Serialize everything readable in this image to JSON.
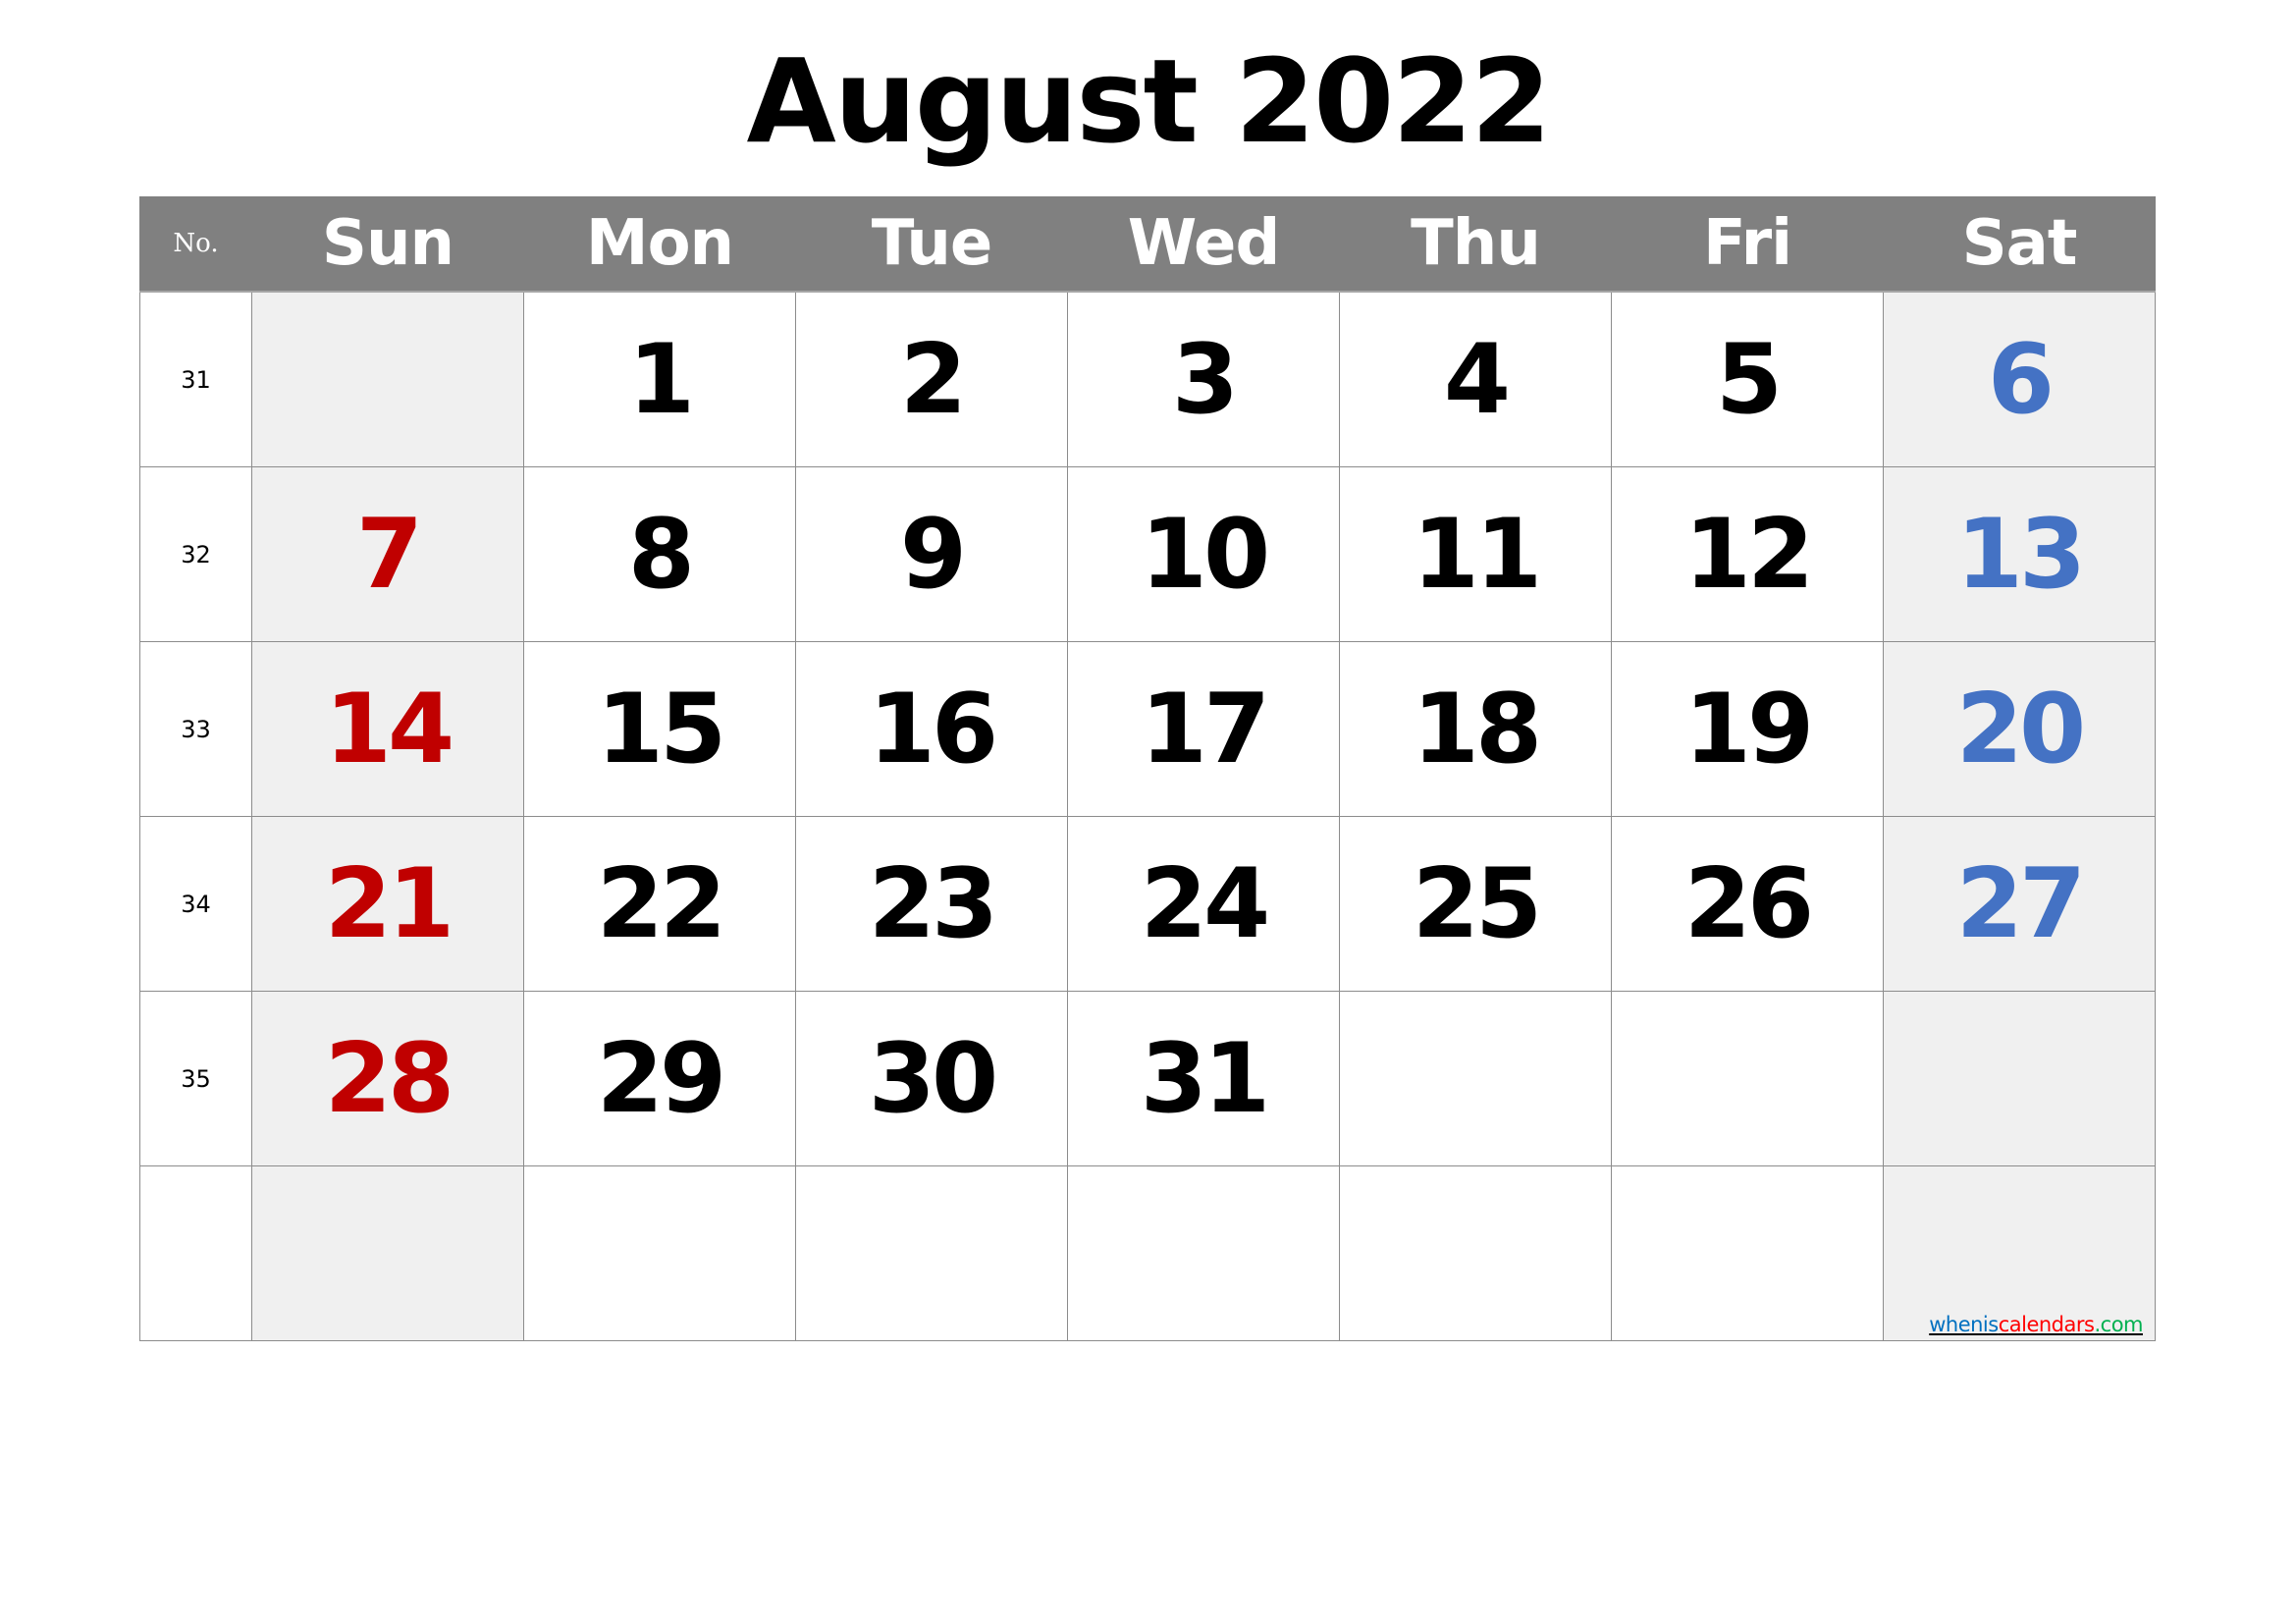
{
  "title": "August 2022",
  "header": {
    "week_col": "No.",
    "days": [
      "Sun",
      "Mon",
      "Tue",
      "Wed",
      "Thu",
      "Fri",
      "Sat"
    ]
  },
  "colors": {
    "header_bg": "#808080",
    "weekend_shade": "#F0F0F0",
    "sunday_text": "#C00000",
    "saturday_text": "#4472C4",
    "weekday_text": "#000000",
    "gridline": "#8C8C8C"
  },
  "weeks": [
    {
      "no": "31",
      "days": [
        "",
        "1",
        "2",
        "3",
        "4",
        "5",
        "6"
      ]
    },
    {
      "no": "32",
      "days": [
        "7",
        "8",
        "9",
        "10",
        "11",
        "12",
        "13"
      ]
    },
    {
      "no": "33",
      "days": [
        "14",
        "15",
        "16",
        "17",
        "18",
        "19",
        "20"
      ]
    },
    {
      "no": "34",
      "days": [
        "21",
        "22",
        "23",
        "24",
        "25",
        "26",
        "27"
      ]
    },
    {
      "no": "35",
      "days": [
        "28",
        "29",
        "30",
        "31",
        "",
        "",
        ""
      ]
    },
    {
      "no": "",
      "days": [
        "",
        "",
        "",
        "",
        "",
        "",
        ""
      ]
    }
  ],
  "watermark": {
    "parts": [
      {
        "text": "whenis",
        "color": "#0070C0"
      },
      {
        "text": "calendars",
        "color": "#FF0000"
      },
      {
        "text": ".com",
        "color": "#00B050"
      }
    ]
  }
}
